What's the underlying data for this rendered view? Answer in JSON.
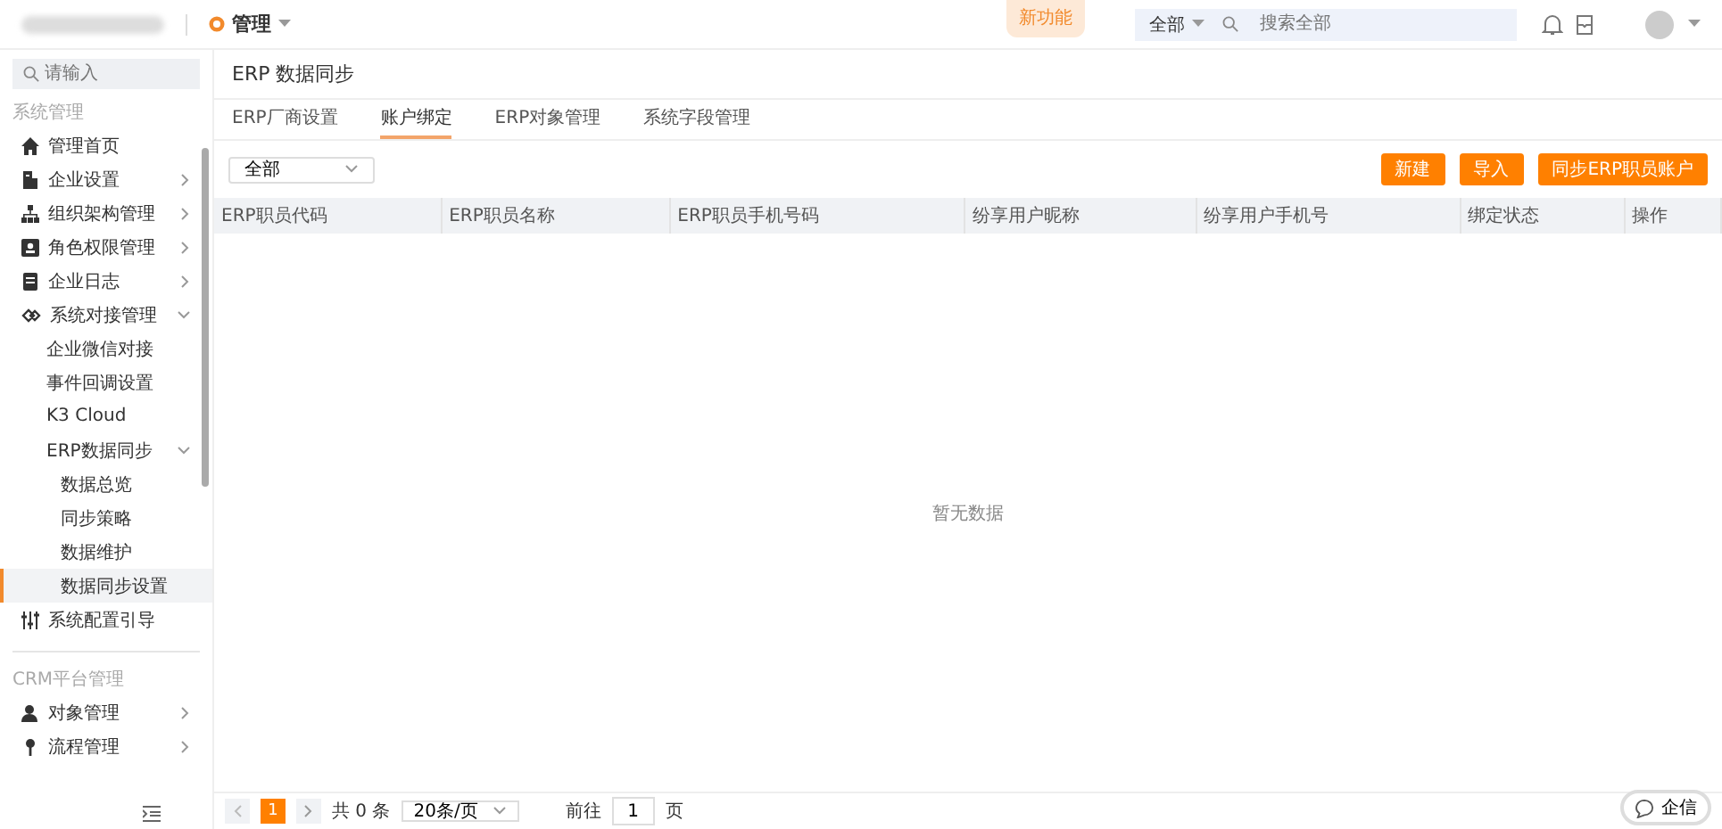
{
  "topbar": {
    "app_menu": "管理",
    "new_badge": "新功能",
    "search_scope": "全部",
    "search_placeholder": "搜索全部"
  },
  "sidebar": {
    "search_placeholder": "请输入",
    "sections": [
      {
        "label": "系统管理",
        "items": [
          {
            "label": "管理首页",
            "selected": false
          },
          {
            "label": "企业设置",
            "selected": false,
            "expanded": false
          },
          {
            "label": "组织架构管理",
            "selected": false,
            "expanded": false
          },
          {
            "label": "角色权限管理",
            "selected": false,
            "expanded": false
          },
          {
            "label": "企业日志",
            "selected": false,
            "expanded": false
          },
          {
            "label": "系统对接管理",
            "selected": false,
            "expanded": true,
            "children": [
              {
                "label": "企业微信对接",
                "selected": false
              },
              {
                "label": "事件回调设置",
                "selected": false
              },
              {
                "label": "K3 Cloud",
                "selected": false
              },
              {
                "label": "ERP数据同步",
                "selected": false,
                "expanded": true,
                "children": [
                  {
                    "label": "数据总览",
                    "selected": false
                  },
                  {
                    "label": "同步策略",
                    "selected": false
                  },
                  {
                    "label": "数据维护",
                    "selected": false
                  },
                  {
                    "label": "数据同步设置",
                    "selected": true
                  }
                ]
              }
            ]
          },
          {
            "label": "系统配置引导",
            "selected": false
          }
        ]
      },
      {
        "label": "CRM平台管理",
        "items": [
          {
            "label": "对象管理",
            "selected": false,
            "expanded": false
          },
          {
            "label": "流程管理",
            "selected": false,
            "expanded": false
          }
        ]
      }
    ]
  },
  "page_title": "ERP 数据同步",
  "tabs": [
    {
      "label": "ERP厂商设置",
      "selected": false
    },
    {
      "label": "账户绑定",
      "selected": true
    },
    {
      "label": "ERP对象管理",
      "selected": false
    },
    {
      "label": "系统字段管理",
      "selected": false
    }
  ],
  "filter": {
    "value": "全部"
  },
  "buttons": [
    "新建",
    "导入",
    "同步ERP职员账户"
  ],
  "table": {
    "columns": [
      "ERP职员代码",
      "ERP职员名称",
      "ERP职员手机号码",
      "纷享用户昵称",
      "纷享用户手机号",
      "绑定状态",
      "操作"
    ],
    "empty_text": "暂无数据"
  },
  "pagination": {
    "pages": [
      {
        "label": "1",
        "selected": true
      }
    ],
    "total": "共 0 条",
    "page_size": "20条/页",
    "goto_label": "前往",
    "goto_value": "1",
    "goto_unit": "页"
  },
  "chat_button": "企信"
}
